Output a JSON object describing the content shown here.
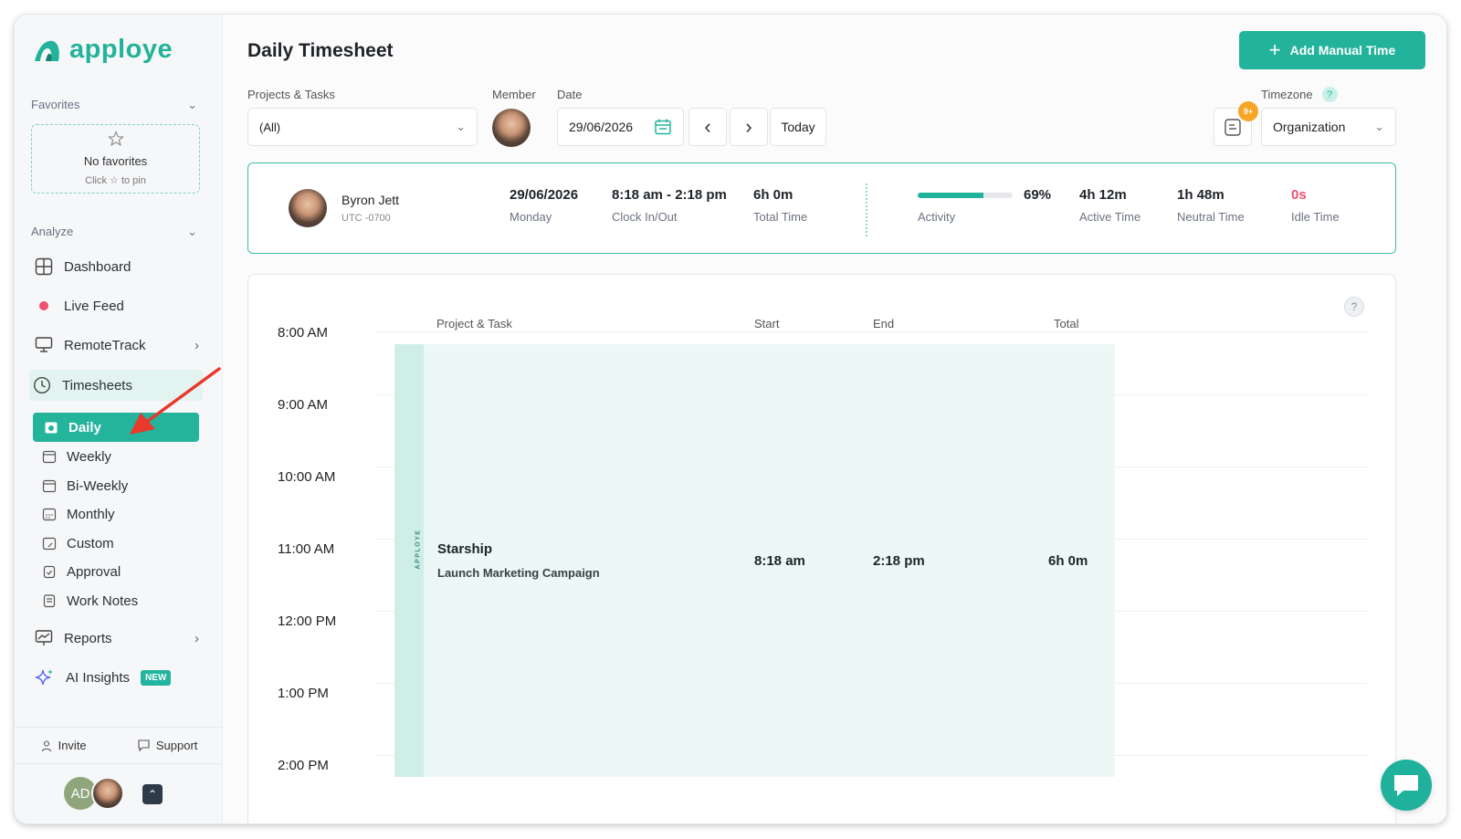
{
  "app": {
    "logo_text": "apploye",
    "brand_color": "#23b39c"
  },
  "sidebar": {
    "favorites_title": "Favorites",
    "favorites_empty": "No favorites",
    "favorites_hint": "Click ☆ to pin",
    "analyze_title": "Analyze",
    "items": [
      {
        "label": "Dashboard",
        "icon": "dashboard-icon"
      },
      {
        "label": "Live Feed",
        "icon": "live-dot-icon"
      },
      {
        "label": "RemoteTrack",
        "icon": "monitor-icon"
      },
      {
        "label": "Timesheets",
        "icon": "clock-icon"
      },
      {
        "label": "Reports",
        "icon": "chart-icon"
      },
      {
        "label": "AI Insights",
        "icon": "sparkle-icon",
        "badge": "NEW"
      }
    ],
    "timesheet_sub": [
      "Daily",
      "Weekly",
      "Bi-Weekly",
      "Monthly",
      "Custom",
      "Approval",
      "Work Notes"
    ],
    "invite": "Invite",
    "support": "Support",
    "user_initials": "AD"
  },
  "header": {
    "title": "Daily Timesheet",
    "add_button": "Add Manual Time"
  },
  "filters": {
    "projects_label": "Projects & Tasks",
    "projects_value": "(All)",
    "member_label": "Member",
    "date_label": "Date",
    "date_value": "29/06/2026",
    "today": "Today",
    "timezone_label": "Timezone",
    "timezone_value": "Organization",
    "notif_badge": "9+"
  },
  "summary": {
    "name": "Byron Jett",
    "tz": "UTC -0700",
    "date": "29/06/2026",
    "weekday": "Monday",
    "clock": "8:18 am - 2:18 pm",
    "clock_label": "Clock In/Out",
    "total": "6h 0m",
    "total_label": "Total Time",
    "activity_pct": "69%",
    "activity_value": 0.69,
    "activity_label": "Activity",
    "active": "4h 12m",
    "active_label": "Active Time",
    "neutral": "1h 48m",
    "neutral_label": "Neutral Time",
    "idle": "0s",
    "idle_label": "Idle Time"
  },
  "timeline": {
    "hours": [
      "8:00 AM",
      "9:00 AM",
      "10:00 AM",
      "11:00 AM",
      "12:00 PM",
      "1:00 PM",
      "2:00 PM"
    ],
    "headers": {
      "project": "Project & Task",
      "start": "Start",
      "end": "End",
      "total": "Total"
    },
    "entry": {
      "source": "APPLOYE",
      "project": "Starship",
      "task": "Launch Marketing Campaign",
      "start": "8:18 am",
      "end": "2:18 pm",
      "total": "6h 0m"
    }
  }
}
